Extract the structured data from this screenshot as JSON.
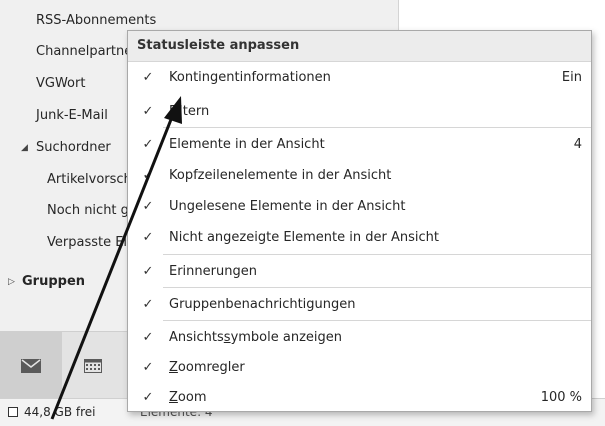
{
  "folders": [
    {
      "label": "RSS-Abonnements"
    },
    {
      "label": "Channelpartner"
    },
    {
      "label": "VGWort"
    },
    {
      "label": "Junk-E-Mail"
    },
    {
      "label": "Suchordner",
      "expander": "◢"
    },
    {
      "label": "Artikelvorschläge"
    },
    {
      "label": "Noch nicht gelesen"
    },
    {
      "label": "Verpasste Elemente"
    },
    {
      "label": "Gruppen",
      "expander": "▷"
    }
  ],
  "status_bar": {
    "quota": "44,8 GB frei",
    "items": "Elemente: 4"
  },
  "menu": {
    "title": "Statusleiste anpassen",
    "items": [
      {
        "check": "✓",
        "label": "Kontingentinformationen",
        "value": "Ein"
      },
      {
        "check": "✓",
        "label": "Filtern",
        "value": ""
      },
      {
        "check": "✓",
        "label": "Elemente in der Ansicht",
        "value": "4"
      },
      {
        "check": "✓",
        "label": "Kopfzeilenelemente in der Ansicht",
        "value": ""
      },
      {
        "check": "✓",
        "label": "Ungelesene Elemente in der Ansicht",
        "value": ""
      },
      {
        "check": "✓",
        "label": "Nicht angezeigte Elemente in der Ansicht",
        "value": ""
      },
      {
        "check": "✓",
        "label": "Erinnerungen",
        "value": ""
      },
      {
        "check": "✓",
        "label": "Gruppenbenachrichtigungen",
        "value": ""
      },
      {
        "check": "✓",
        "label": "Ansichtssymbole anzeigen",
        "value": ""
      },
      {
        "check": "✓",
        "label": "Zoomregler",
        "value": ""
      },
      {
        "check": "✓",
        "label": "Zoom",
        "value": "100 %"
      }
    ]
  },
  "nav": {
    "mail_icon": "mail-icon",
    "calendar_icon": "calendar-icon"
  }
}
